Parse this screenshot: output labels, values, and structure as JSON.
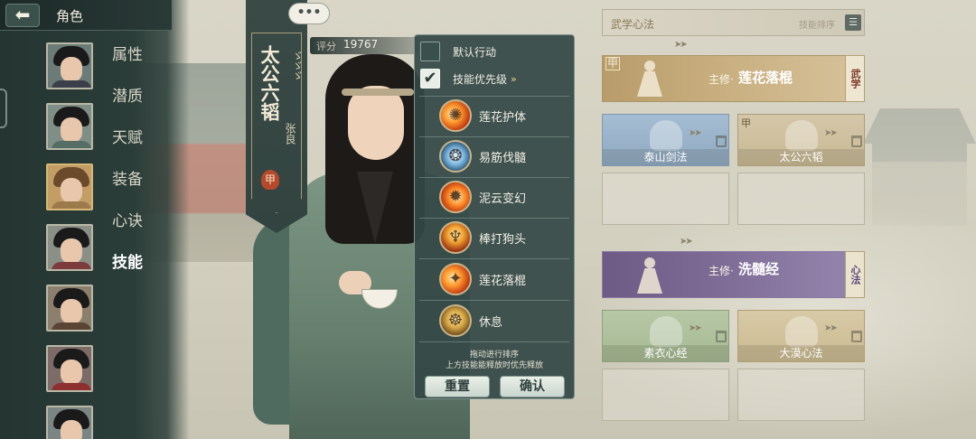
{
  "nav": {
    "back_icon": "back-arrow-icon",
    "title": "角色",
    "menu": [
      "属性",
      "潜质",
      "天赋",
      "装备",
      "心诀",
      "技能"
    ],
    "active_index": 5
  },
  "character": {
    "banner_title": "太公六韬",
    "banner_name": "张良",
    "banner_rune": "ゞゞゞ",
    "banner_seal": "甲",
    "chat_bubble": "•••",
    "score_label": "评分",
    "score_value": "19767"
  },
  "skill_popup": {
    "default_action": {
      "label": "默认行动",
      "checked": false
    },
    "priority": {
      "label": "技能优先级",
      "checked": true,
      "arrow": "»"
    },
    "skills": [
      {
        "name": "莲花护体",
        "icon": "fire-lotus-icon"
      },
      {
        "name": "易筋伐髓",
        "icon": "water-swirl-icon"
      },
      {
        "name": "泥云变幻",
        "icon": "flame-swirl-icon"
      },
      {
        "name": "棒打狗头",
        "icon": "staff-strike-icon"
      },
      {
        "name": "莲花落棍",
        "icon": "lotus-staff-icon"
      },
      {
        "name": "休息",
        "icon": "meditate-icon"
      }
    ],
    "hint_line1": "拖动进行排序",
    "hint_line2": "上方技能能释放时优先释放",
    "reset_label": "重置",
    "confirm_label": "确认"
  },
  "martial": {
    "header_title": "武学心法",
    "sort_label": "技能排序",
    "sort_icon": "sort-icon",
    "main_prefix": "主修·",
    "group1": {
      "tag": "甲",
      "main_name": "莲花落棍",
      "side_tag": "武学",
      "slots": [
        {
          "name": "泰山剑法",
          "tag": ""
        },
        {
          "name": "太公六韬",
          "tag": "甲"
        }
      ]
    },
    "group2": {
      "main_name": "洗髓经",
      "side_tag": "心法",
      "slots": [
        {
          "name": "素衣心经"
        },
        {
          "name": "大漠心法"
        }
      ]
    }
  },
  "colors": {
    "panel_dark": "#2b3d39",
    "popup_bg": "#344846",
    "gold_bar": "#c7ad7d",
    "purple_bar": "#7e6c97",
    "seal_red": "#b5492e"
  }
}
